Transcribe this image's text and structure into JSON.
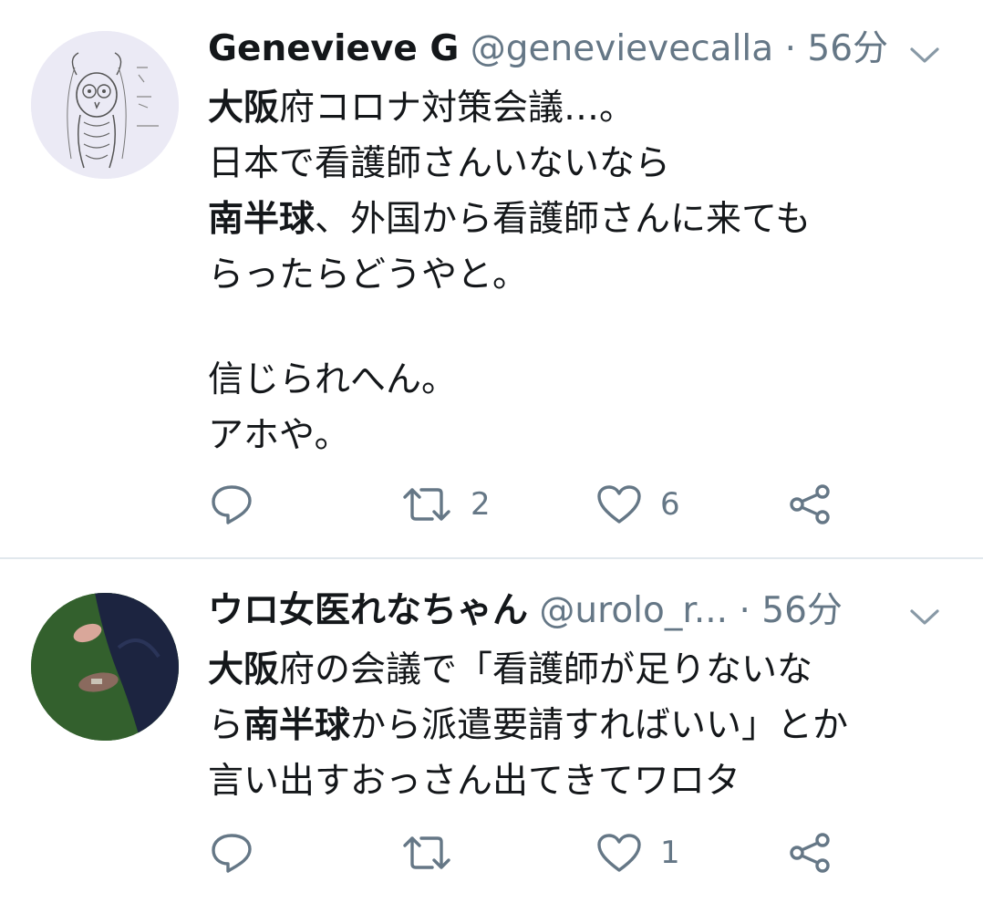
{
  "tweets": [
    {
      "name": "Genevieve G",
      "handle": "@genevievecalla",
      "dot": "·",
      "time": "56分",
      "lines": [
        [
          {
            "t": "大阪",
            "b": true
          },
          {
            "t": "府コロナ対策会議…。",
            "b": false
          }
        ],
        [
          {
            "t": "日本で看護師さんいないなら",
            "b": false
          }
        ],
        [
          {
            "t": "南半球",
            "b": true
          },
          {
            "t": "、外国から看護師さんに来ても",
            "b": false
          }
        ],
        [
          {
            "t": "らったらどうやと。",
            "b": false
          }
        ],
        [],
        [
          {
            "t": "信じられへん。",
            "b": false
          }
        ],
        [
          {
            "t": "アホや。",
            "b": false
          }
        ]
      ],
      "actions": {
        "reply_count": "",
        "retweet_count": "2",
        "like_count": "6"
      }
    },
    {
      "name": "ウロ女医れなちゃん",
      "handle": "@urolo_r...",
      "dot": "·",
      "time": "56分",
      "lines": [
        [
          {
            "t": "大阪",
            "b": true
          },
          {
            "t": "府の会議で「看護師が足りないな",
            "b": false
          }
        ],
        [
          {
            "t": "ら",
            "b": false
          },
          {
            "t": "南半球",
            "b": true
          },
          {
            "t": "から派遣要請すればいい」とか",
            "b": false
          }
        ],
        [
          {
            "t": "言い出すおっさん出てきてワロタ",
            "b": false
          }
        ]
      ],
      "actions": {
        "reply_count": "",
        "retweet_count": "",
        "like_count": "1"
      }
    }
  ],
  "icons": {
    "more": "chevron-down-icon",
    "reply": "reply-icon",
    "retweet": "retweet-icon",
    "like": "heart-icon",
    "share": "share-icon"
  },
  "colors": {
    "text": "#14171a",
    "secondary": "#657786",
    "divider": "#e1e8ed",
    "icon": "#657786"
  }
}
